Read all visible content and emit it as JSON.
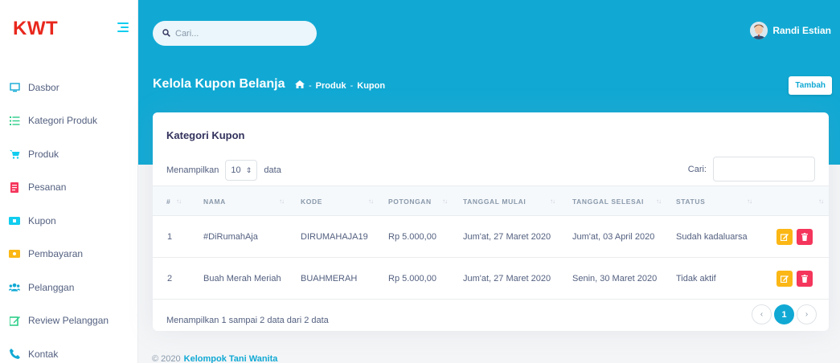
{
  "brand": "KWT",
  "sidebar": {
    "items": [
      {
        "label": "Dasbor",
        "icon": "monitor-icon"
      },
      {
        "label": "Kategori Produk",
        "icon": "list-icon"
      },
      {
        "label": "Produk",
        "icon": "cart-icon"
      },
      {
        "label": "Pesanan",
        "icon": "document-icon"
      },
      {
        "label": "Kupon",
        "icon": "coupon-icon"
      },
      {
        "label": "Pembayaran",
        "icon": "money-icon"
      },
      {
        "label": "Pelanggan",
        "icon": "users-icon"
      },
      {
        "label": "Review Pelanggan",
        "icon": "edit-icon"
      },
      {
        "label": "Kontak",
        "icon": "phone-icon"
      }
    ]
  },
  "header": {
    "search_placeholder": "Cari...",
    "user_name": "Randi Estian",
    "page_title": "Kelola Kupon Belanja",
    "breadcrumb": [
      "Produk",
      "Kupon"
    ],
    "breadcrumb_sep": "-",
    "add_button": "Tambah"
  },
  "card": {
    "title": "Kategori Kupon",
    "length_prefix": "Menampilkan",
    "length_value": "10",
    "length_suffix": "data",
    "filter_label": "Cari:",
    "columns": [
      "#",
      "NAMA",
      "KODE",
      "POTONGAN",
      "TANGGAL MULAI",
      "TANGGAL SELESAI",
      "STATUS",
      ""
    ],
    "rows": [
      {
        "no": "1",
        "nama": "#DiRumahAja",
        "kode": "DIRUMAHAJA19",
        "potongan": "Rp 5.000,00",
        "mulai": "Jum'at, 27 Maret 2020",
        "selesai": "Jum'at, 03 April 2020",
        "status": "Sudah kadaluarsa"
      },
      {
        "no": "2",
        "nama": "Buah Merah Meriah",
        "kode": "BUAHMERAH",
        "potongan": "Rp 5.000,00",
        "mulai": "Jum'at, 27 Maret 2020",
        "selesai": "Senin, 30 Maret 2020",
        "status": "Tidak aktif"
      }
    ],
    "info": "Menampilkan 1 sampai 2 data dari 2 data",
    "pagination": {
      "prev": "‹",
      "current": "1",
      "next": "›"
    }
  },
  "footer": {
    "copyright": "© 2020",
    "link": "Kelompok Tani Wanita"
  },
  "colors": {
    "accent": "#11a9d4",
    "brand": "#e8271d",
    "warning": "#fbb715",
    "danger": "#f5365c"
  }
}
